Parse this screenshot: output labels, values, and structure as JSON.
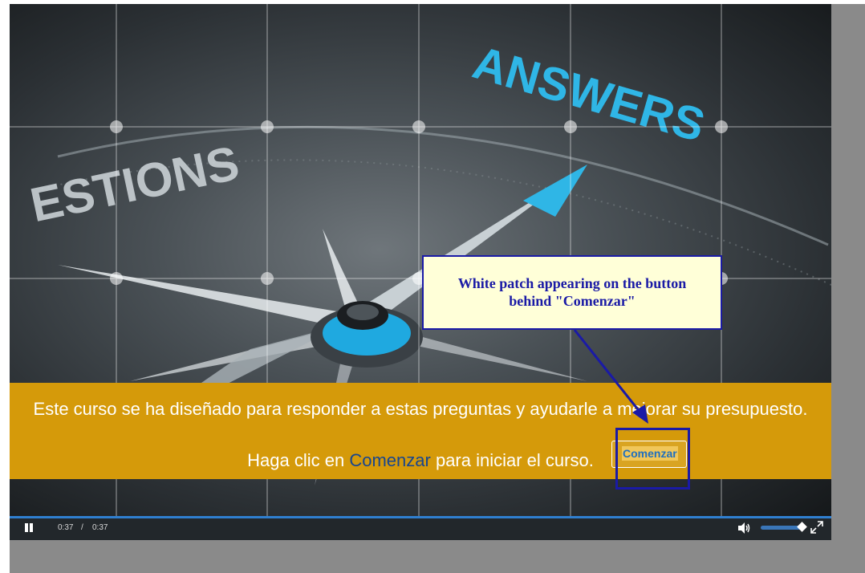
{
  "scene": {
    "word_left": "ESTIONS",
    "word_right": "ANSWERS"
  },
  "banner": {
    "line1": "Este curso se ha diseñado para responder a estas preguntas y ayudarle a mejorar su presupuesto.",
    "line2_prefix": "Haga clic en ",
    "line2_keyword": "Comenzar",
    "line2_suffix": " para iniciar el curso.",
    "start_button_label": "Comenzar"
  },
  "controls": {
    "current_time": "0:37",
    "separator": "/",
    "total_time": "0:37",
    "progress": 1.0,
    "volume": 1.0
  },
  "annotation": {
    "text": "White patch appearing on the button\nbehind \"Comenzar\""
  },
  "icons": [
    "pause-icon",
    "volume-icon",
    "fullscreen-icon"
  ],
  "colors": {
    "banner": "#d59a0a",
    "keyword": "#17458f",
    "annotation_border": "#1a1aa6",
    "annotation_fill": "#ffffd8",
    "accent_cyan": "#1fa9e0"
  }
}
